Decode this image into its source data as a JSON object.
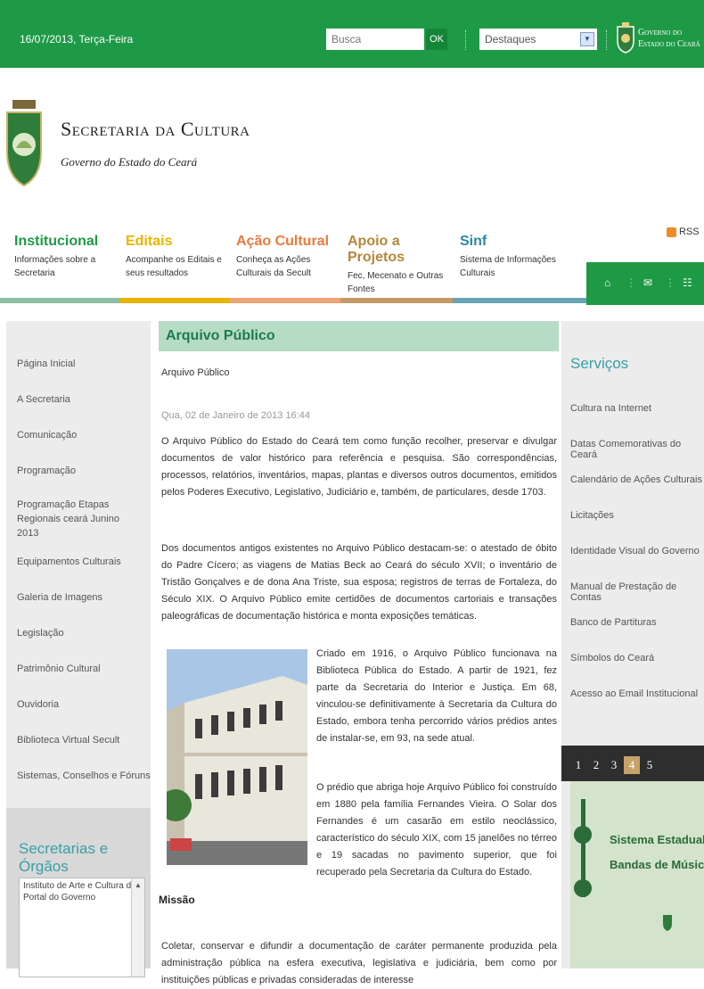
{
  "topbar": {
    "date": "16/07/2013, Terça-Feira",
    "search_placeholder": "Busca",
    "ok_label": "OK",
    "destaques_value": "Destaques",
    "gov_line1": "Governo do",
    "gov_line2": "Estado do Ceará"
  },
  "header": {
    "title": "Secretaria da Cultura",
    "subtitle": "Governo do Estado do Ceará"
  },
  "nav": {
    "rss": "RSS",
    "items": [
      {
        "title": "Institucional",
        "desc": "Informações sobre a Secretaria",
        "color": "#1e9a46"
      },
      {
        "title": "Editais",
        "desc": "Acompanhe os Editais e seus resultados",
        "color": "#e8b400"
      },
      {
        "title": "Ação Cultural",
        "desc": "Conheça as Ações Culturais da Secult",
        "color": "#e87b3d"
      },
      {
        "title": "Apoio a Projetos",
        "desc": "Fec, Mecenato e Outras Fontes",
        "color": "#b5863d"
      },
      {
        "title": "Sinf",
        "desc": "Sistema de Informações Culturais",
        "color": "#2d88a0"
      }
    ]
  },
  "left_menu": [
    "Página Inicial",
    "A Secretaria",
    "Comunicação",
    "Programação",
    "Programação Etapas Regionais ceará Junino 2013",
    "Equipamentos Culturais",
    "Galeria de Imagens",
    "Legislação",
    "Patrimônio Cultural",
    "Ouvidoria",
    "Biblioteca Virtual Secult",
    "Sistemas, Conselhos e Fóruns"
  ],
  "secretarias": {
    "title": "Secretarias e Órgãos",
    "options": [
      "Instituto de Arte e Cultura do C",
      "Portal do Governo"
    ]
  },
  "article": {
    "title": "Arquivo Público",
    "subtitle": "Arquivo Público",
    "meta": "Qua, 02 de Janeiro de 2013 16:44",
    "p1": "O Arquivo Público do Estado do Ceará tem como função recolher, preservar e divulgar documentos de valor histórico para referência e pesquisa. São correspondências, processos, relatórios, inventários, mapas, plantas e diversos outros documentos, emitidos pelos Poderes Executivo, Legislativo, Judiciário e, também, de particulares, desde 1703.",
    "p2": "Dos documentos antigos existentes no Arquivo Público destacam-se: o atestado de óbito do Padre Cícero; as viagens de Matias Beck ao Ceará do século XVII; o inventário de Tristão Gonçalves e de dona Ana Triste, sua esposa; registros de terras de Fortaleza, do Século XIX. O Arquivo Público emite certidões de documentos cartoriais e transações paleográficas de documentação histórica e monta exposições temáticas.",
    "p3": "Criado em 1916, o Arquivo Público funcionava na Biblioteca Pública do Estado. A partir de 1921, fez parte da Secretaria do Interior e Justiça. Em 68, vinculou-se definitivamente à Secretaria da Cultura do Estado, embora tenha percorrido vários prédios antes de instalar-se, em 93, na sede atual.",
    "p4": "O prédio que abriga hoje Arquivo Público foi construído em 1880 pela família Fernandes Vieira. O Solar dos Fernandes é um casarão em estilo neoclássico, característico do século XIX, com 15 janelões no térreo e 19 sacadas no pavimento superior, que foi recuperado pela Secretaria da Cultura do Estado.",
    "missao": "Missão",
    "p5": "Coletar, conservar e difundir a documentação de caráter permanente produzida pela administração pública na esfera executiva, legislativa e judiciária, bem como por instituições públicas e privadas consideradas de interesse"
  },
  "servicos": {
    "title": "Serviços",
    "links": [
      "Cultura na Internet",
      "Datas Comemorativas do Ceará",
      "Calendário de Ações Culturais",
      "Licitações",
      "Identidade Visual do Governo",
      "Manual de Prestação de Contas",
      "Banco de Partituras",
      "Símbolos do Ceará",
      "Acesso ao Email Institucional"
    ]
  },
  "pager": {
    "pages": [
      "1",
      "2",
      "3",
      "4",
      "5"
    ],
    "active": "4"
  },
  "banner": {
    "line1": "Sistema Estadual",
    "line2": "Bandas de Música"
  }
}
